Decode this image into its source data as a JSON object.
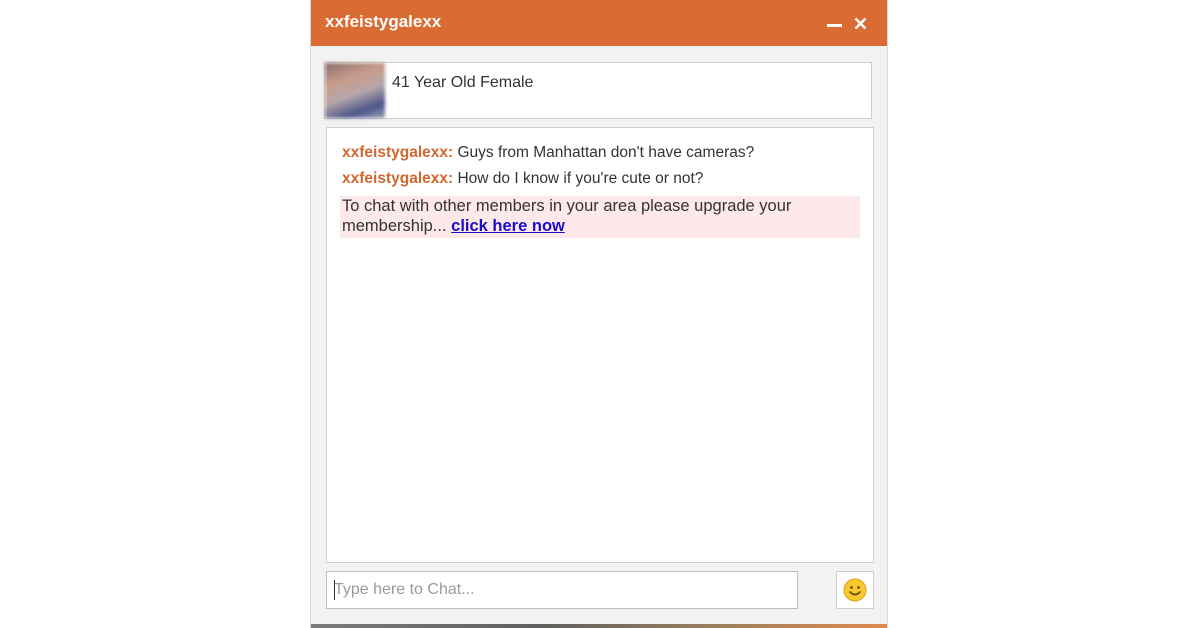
{
  "window": {
    "title": "xxfeistygalexx",
    "minimize_icon": "minimize-icon",
    "close_icon": "close-icon",
    "accent_color": "#d96b33"
  },
  "profile": {
    "description": "41 Year Old Female"
  },
  "messages": [
    {
      "sender": "xxfeistygalexx:",
      "text": "Guys from Manhattan don't have cameras?"
    },
    {
      "sender": "xxfeistygalexx:",
      "text": "How do I know if you're cute or not?"
    }
  ],
  "promo": {
    "text": "To chat with other members in your area please upgrade your membership...",
    "link_label": "click here now"
  },
  "composer": {
    "placeholder": "Type here to Chat...",
    "emoji_icon": "smiley-icon"
  }
}
